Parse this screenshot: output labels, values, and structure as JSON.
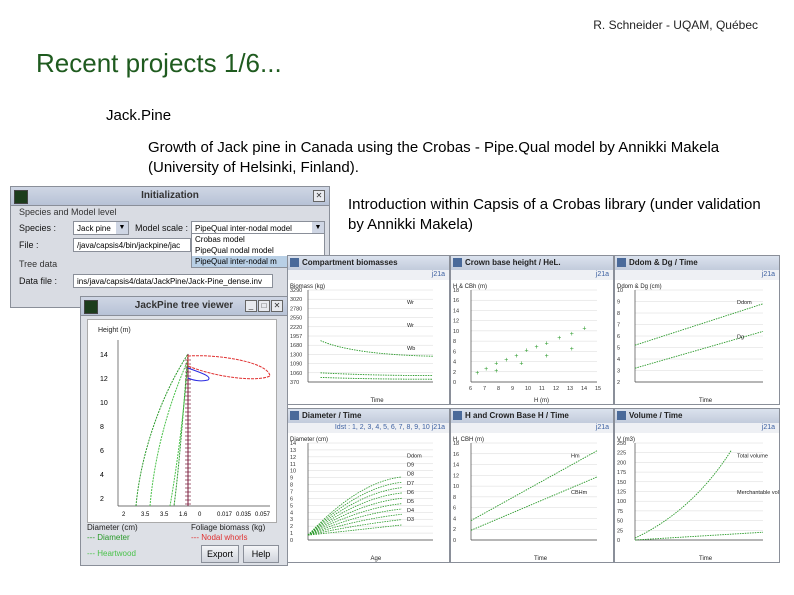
{
  "header": {
    "credit": "R. Schneider - UQAM, Québec"
  },
  "title": "Recent projects 1/6...",
  "bullets": {
    "level1": "Jack.Pine",
    "level2": "Growth of Jack pine in Canada using the Crobas - Pipe.Qual model by Annikki Makela (University of Helsinki, Finland).",
    "level3": "Introduction within Capsis of a Crobas library (under validation by Annikki Makela)"
  },
  "init_window": {
    "title": "Initialization",
    "section_species": "Species and Model level",
    "species_label": "Species :",
    "species_value": "Jack pine",
    "model_scale_label": "Model scale :",
    "model_scale_value": "PipeQual inter-nodal model",
    "file_label": "File :",
    "file_value": "/java/capsis4/bin/jackpine/jac",
    "dropdown": [
      "Crobas model",
      "PipeQual nodal model",
      "PipeQual inter-nodal m"
    ],
    "section_tree": "Tree data",
    "datafile_label": "Data file :",
    "datafile_value": "ins/java/capsis4/data/JackPine/Jack-Pine_dense.inv"
  },
  "tree_viewer": {
    "title": "JackPine tree viewer",
    "y_label": "Height (m)",
    "x_left_label": "Diameter (cm)",
    "x_right_label": "Foliage biomass (kg)",
    "y_ticks": [
      "14",
      "12",
      "10",
      "8",
      "6",
      "4",
      "2"
    ],
    "x_ticks": [
      "2",
      "3.5",
      "3.5",
      "1.6",
      "0",
      "0.017",
      "0.035",
      "0.057"
    ],
    "legend": [
      "Diameter",
      "Heartwood",
      "Nodal whorls",
      "Inter-nodal whorls"
    ],
    "export_label": "Export",
    "help_label": "Help"
  },
  "charts": [
    {
      "title": "Compartment biomasses",
      "sub": "j21a",
      "ylabel": "Biomass (kg)",
      "xlabel": "Time",
      "labels": [
        "Wr",
        "Wr",
        "Wb"
      ],
      "y_ticks": [
        "3290",
        "3020",
        "2780",
        "2550",
        "2220",
        "1957",
        "1680",
        "1300",
        "1090",
        "1060",
        "370"
      ]
    },
    {
      "title": "Crown base height / HeL.",
      "sub": "j21a",
      "ylabel": "H & CBh (m)",
      "xlabel": "H (m)",
      "y_ticks": [
        "18",
        "16",
        "14",
        "12",
        "10",
        "8",
        "6",
        "4",
        "2",
        "0"
      ],
      "x_ticks": [
        "6",
        "7",
        "8",
        "9",
        "10",
        "11",
        "12",
        "13",
        "14",
        "15"
      ]
    },
    {
      "title": "Ddom & Dg / Time",
      "sub": "j21a",
      "ylabel": "Ddom & Dg (cm)",
      "xlabel": "Time",
      "labels": [
        "Ddom",
        "Dg"
      ],
      "y_ticks": [
        "10",
        "9",
        "8",
        "7",
        "6",
        "5",
        "4",
        "3",
        "2"
      ]
    },
    {
      "title": "Diameter / Time",
      "sub": "j21a",
      "ylabel": "Diameter (cm)",
      "xlabel": "Age",
      "legend": "Idst : 1, 2, 3, 4, 5, 6, 7, 8, 9, 10",
      "labels": [
        "Ddom",
        "D9",
        "D8",
        "D7",
        "D6",
        "D5",
        "D4",
        "D3"
      ],
      "y_ticks": [
        "14",
        "13",
        "12",
        "11",
        "10",
        "9",
        "8",
        "7",
        "6",
        "5",
        "4",
        "3",
        "2",
        "1",
        "0"
      ]
    },
    {
      "title": "H and Crown Base H / Time",
      "sub": "j21a",
      "ylabel": "H, CBH (m)",
      "xlabel": "Time",
      "labels": [
        "Hm",
        "CBHm"
      ],
      "y_ticks": [
        "18",
        "16",
        "14",
        "12",
        "10",
        "8",
        "6",
        "4",
        "2",
        "0"
      ]
    },
    {
      "title": "Volume / Time",
      "sub": "j21a",
      "ylabel": "V (m3)",
      "xlabel": "Time",
      "labels": [
        "Total volume",
        "Merchantable volume"
      ],
      "y_ticks": [
        "250",
        "225",
        "200",
        "175",
        "150",
        "125",
        "100",
        "75",
        "50",
        "25",
        "0"
      ]
    }
  ]
}
